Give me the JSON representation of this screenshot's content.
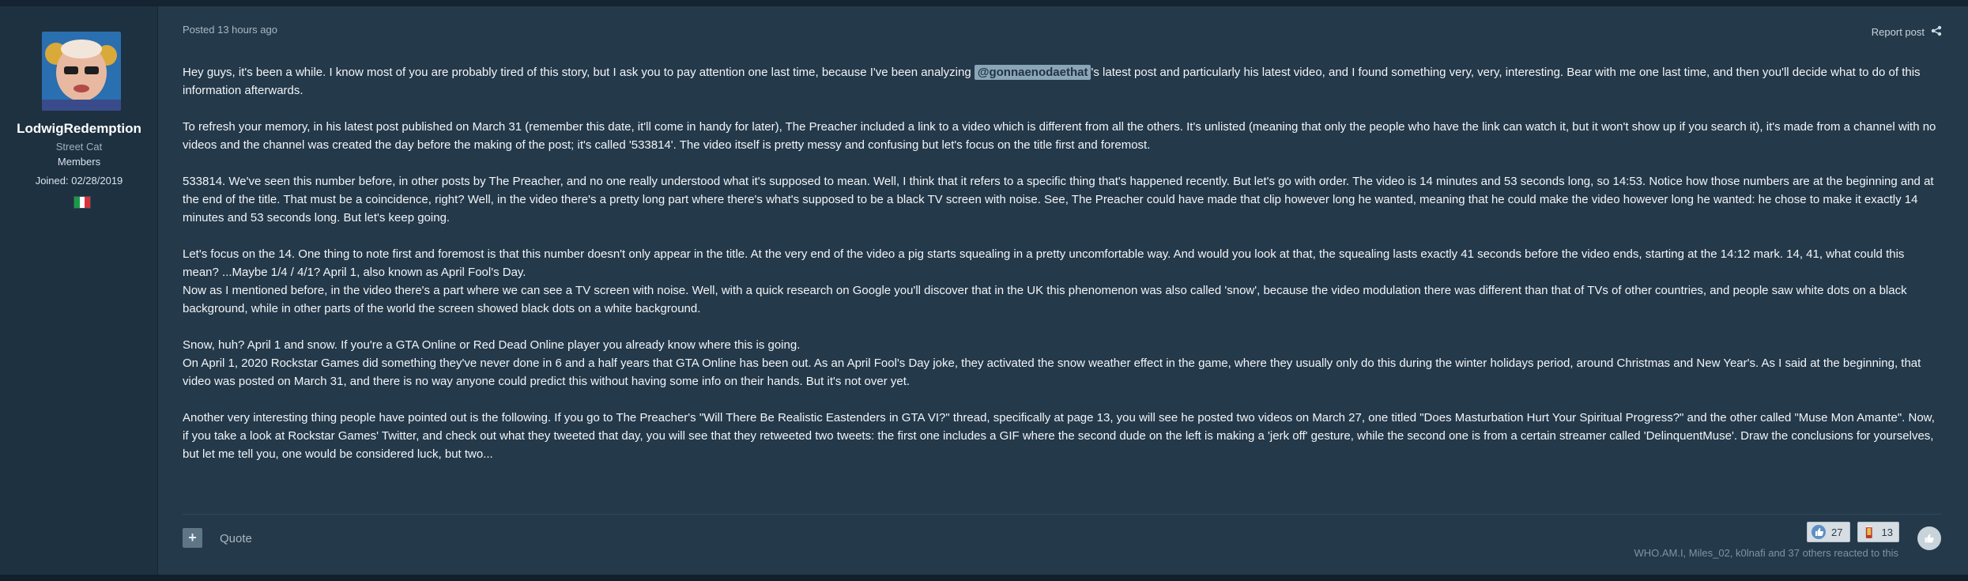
{
  "author": {
    "name": "LodwigRedemption",
    "title": "Street Cat",
    "group": "Members",
    "joined": "Joined: 02/28/2019",
    "flag": "italy-flag"
  },
  "post": {
    "posted": "Posted 13 hours ago",
    "report_label": "Report post",
    "mention": "@gonnaenodaethat",
    "p1_before": "Hey guys, it's been a while. I know most of you are probably tired of this story, but I ask you to pay attention one last time, because I've been analyzing ",
    "p1_after": "'s latest post and particularly his latest video, and I found something very, very, interesting. Bear with me one last time, and then you'll decide what to do of this information afterwards.",
    "p2": "To refresh your memory, in his latest post published on March 31 (remember this date, it'll come in handy for later), The Preacher included a link to a video which is different from all the others. It's unlisted (meaning that only the people who have the link can watch it, but it won't show up if you search it), it's made from a channel with no videos and the channel was created the day before the making of the post; it's called '533814'. The video itself is pretty messy and confusing but let's focus on the title first and foremost.",
    "p3": "533814. We've seen this number before, in other posts by The Preacher, and no one really understood what it's supposed to mean. Well, I think that it refers to a specific thing that's happened recently. But let's go with order. The video is 14 minutes and 53 seconds long, so 14:53. Notice how those numbers are at the beginning and at the end of the title. That must be a coincidence, right? Well, in the video there's a pretty long part where there's what's supposed to be a black TV screen with noise. See, The Preacher could have made that clip however long he wanted, meaning that he could make the video however long he wanted: he chose to make it exactly 14 minutes and 53 seconds long. But let's keep going.",
    "p4a": "Let's focus on the 14. One thing to note first and foremost is that this number doesn't only appear in the title. At the very end of the video a pig starts squealing in a pretty uncomfortable way. And would you look at that, the squealing lasts exactly 41 seconds before the video ends, starting at the 14:12 mark. 14, 41, what could this mean? ...Maybe 1/4 / 4/1? April 1, also known as April Fool's Day.",
    "p4b": "Now as I mentioned before, in the video there's a part where we can see a TV screen with noise. Well, with a quick research on Google you'll discover that in the UK this phenomenon was also called 'snow', because the video modulation there was different than that of TVs of other countries, and people saw white dots on a black background, while in other parts of the world the screen showed black dots on a white background.",
    "p5a": "Snow, huh? April 1 and snow. If you're a GTA Online or Red Dead Online player you already know where this is going.",
    "p5b": "On April 1, 2020 Rockstar Games did something they've never done in 6 and a half years that GTA Online has been out. As an April Fool's Day joke, they activated the snow weather effect in the game, where they usually only do this during the winter holidays period, around Christmas and New Year's. As I said at the beginning, that video was posted on March 31, and there is no way anyone could predict this without having some info on their hands. But it's not over yet.",
    "p6": "Another very interesting thing people have pointed out is the following. If you go to The Preacher's \"Will There Be Realistic Eastenders in GTA VI?\" thread, specifically at page 13, you will see he posted two videos on March 27, one titled \"Does Masturbation Hurt Your Spiritual Progress?\" and the other called \"Muse Mon Amante\". Now, if you take a look at Rockstar Games' Twitter, and check out what they tweeted that day, you will see that they retweeted two tweets: the first one includes a GIF where the second dude on the left is making a 'jerk off' gesture, while the second one is from a certain streamer called 'DelinquentMuse'. Draw the conclusions for yourselves, but let me tell you, one would be considered luck, but two..."
  },
  "footer": {
    "plus_label": "+",
    "quote_label": "Quote",
    "reactions": [
      {
        "icon": "thumbs-up-icon",
        "count": "27"
      },
      {
        "icon": "beer-icon",
        "count": "13"
      }
    ],
    "reactors_text": "WHO.AM.I, Miles_02, k0lnafi and 37 others reacted to this"
  }
}
